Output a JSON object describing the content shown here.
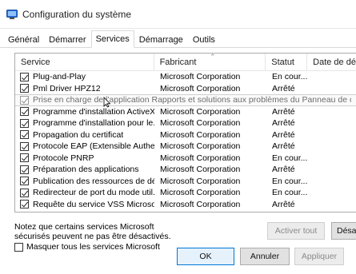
{
  "window": {
    "title": "Configuration du système"
  },
  "tabs": [
    {
      "label": "Général"
    },
    {
      "label": "Démarrer"
    },
    {
      "label": "Services"
    },
    {
      "label": "Démarrage"
    },
    {
      "label": "Outils"
    }
  ],
  "active_tab": "Services",
  "table": {
    "headers": [
      "Service",
      "Fabricant",
      "Statut",
      "Date de dés"
    ],
    "rows": [
      {
        "name": "Plug-and-Play",
        "manufacturer": "Microsoft Corporation",
        "status": "En cour...",
        "checked": true
      },
      {
        "name": "Pml Driver HPZ12",
        "manufacturer": "Microsoft Corporation",
        "status": "Arrêté",
        "checked": true
      },
      {
        "name": "Prise en charge de l'application Rapports et solutions aux problèmes du Panneau de configura",
        "manufacturer": "",
        "status": "",
        "checked": true,
        "disabled": true
      },
      {
        "name": "Programme d'installation ActiveX...",
        "manufacturer": "Microsoft Corporation",
        "status": "Arrêté",
        "checked": true
      },
      {
        "name": "Programme d'installation pour le...",
        "manufacturer": "Microsoft Corporation",
        "status": "Arrêté",
        "checked": true
      },
      {
        "name": "Propagation du certificat",
        "manufacturer": "Microsoft Corporation",
        "status": "Arrêté",
        "checked": true
      },
      {
        "name": "Protocole EAP (Extensible Authe...",
        "manufacturer": "Microsoft Corporation",
        "status": "Arrêté",
        "checked": true
      },
      {
        "name": "Protocole PNRP",
        "manufacturer": "Microsoft Corporation",
        "status": "En cour...",
        "checked": true
      },
      {
        "name": "Préparation des applications",
        "manufacturer": "Microsoft Corporation",
        "status": "Arrêté",
        "checked": true
      },
      {
        "name": "Publication des ressources de dé...",
        "manufacturer": "Microsoft Corporation",
        "status": "En cour...",
        "checked": true
      },
      {
        "name": "Redirecteur de port du mode util...",
        "manufacturer": "Microsoft Corporation",
        "status": "En cour...",
        "checked": true
      },
      {
        "name": "Requête du service VSS Microso...",
        "manufacturer": "Microsoft Corporation",
        "status": "Arrêté",
        "checked": true
      }
    ]
  },
  "note": "Notez que certains services Microsoft sécurisés peuvent ne pas être désactivés.",
  "hide_ms_label": "Masquer tous les services Microsoft",
  "buttons": {
    "enable_all": "Activer tout",
    "disable_all": "Désa",
    "ok": "OK",
    "cancel": "Annuler",
    "apply": "Appliquer"
  },
  "colors": {
    "title_icon": "#2b6fd6",
    "default_button_border": "#0078d7"
  }
}
